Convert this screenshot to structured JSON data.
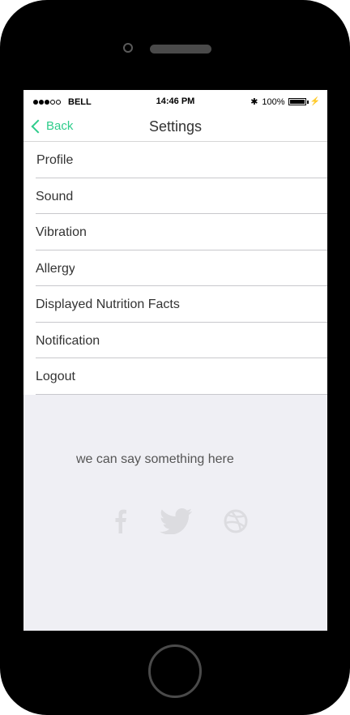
{
  "status_bar": {
    "carrier": "BELL",
    "time": "14:46 PM",
    "battery": "100%",
    "bluetooth_glyph": "✱",
    "charge_glyph": "⚡"
  },
  "nav": {
    "back_label": "Back",
    "title": "Settings"
  },
  "settings_items": [
    {
      "label": "Profile"
    },
    {
      "label": "Sound"
    },
    {
      "label": "Vibration"
    },
    {
      "label": "Allergy"
    },
    {
      "label": "Displayed Nutrition Facts"
    },
    {
      "label": "Notification"
    },
    {
      "label": "Logout"
    }
  ],
  "footer": {
    "text": "we can say something here"
  },
  "social": [
    "facebook-icon",
    "twitter-icon",
    "dribbble-icon"
  ],
  "colors": {
    "accent": "#2ecc8b",
    "background": "#efeff4"
  }
}
